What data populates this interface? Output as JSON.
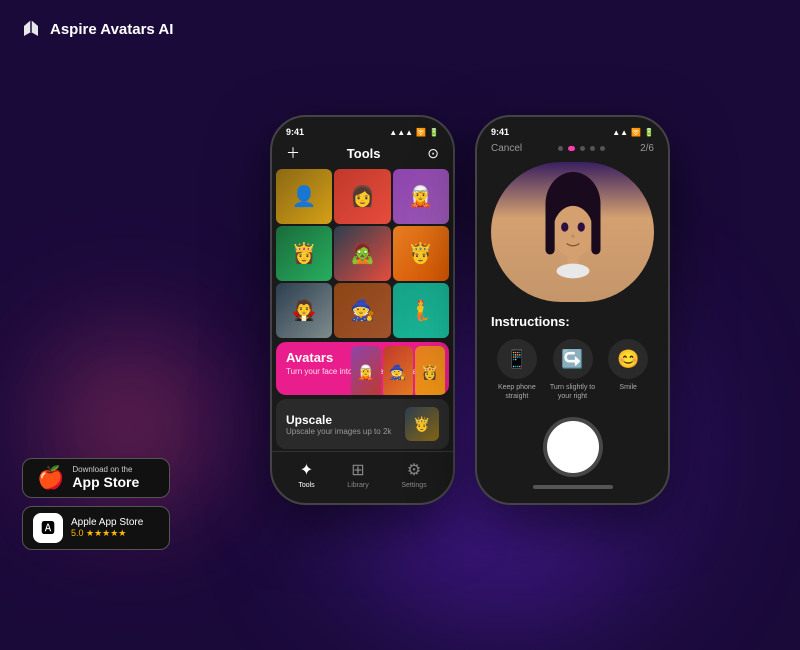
{
  "header": {
    "logo_alt": "Aspire Avatars AI Logo",
    "title": "Aspire Avatars AI"
  },
  "badges": {
    "download_label_small": "Download on the",
    "download_label_big": "App Store",
    "rating_name": "Apple App Store",
    "rating_score": "5.0",
    "stars": "★★★★★"
  },
  "phone1": {
    "status_time": "9:41",
    "toolbar_title": "Tools",
    "avatars_title": "Avatars",
    "avatars_sub": "Turn your face into AI-powered avatars.",
    "upscale_title": "Upscale",
    "upscale_sub": "Upscale your images up to 2k",
    "nav_tools": "Tools",
    "nav_library": "Library",
    "nav_settings": "Settings"
  },
  "phone2": {
    "status_time": "9:41",
    "cancel_label": "Cancel",
    "counter_label": "2/6",
    "instructions_title": "Instructions:",
    "instruction1_label": "Keep phone straight",
    "instruction2_label": "Turn slightly to your right",
    "instruction3_label": "Smile"
  },
  "colors": {
    "accent_pink": "#e91e8c",
    "bg_dark": "#1a0a3a",
    "phone_dark": "#1a1a1a"
  }
}
